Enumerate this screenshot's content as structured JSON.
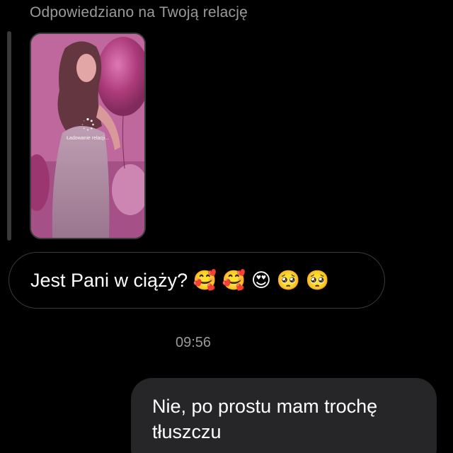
{
  "reply_context": {
    "label": "Odpowiedziano na Twoją relację",
    "story_loading_text": "Ładowanie relacji..."
  },
  "messages": [
    {
      "direction": "incoming",
      "text": "Jest Pani w ciąży? 🥰 🥰 😍 🥺 🥺"
    },
    {
      "direction": "outgoing",
      "text": "Nie, po prostu mam trochę tłuszczu"
    }
  ],
  "timestamp": "09:56",
  "colors": {
    "background": "#000000",
    "outgoing_bubble": "#262628",
    "incoming_border": "#3a3a3c",
    "secondary_text": "#9a9a9a"
  }
}
